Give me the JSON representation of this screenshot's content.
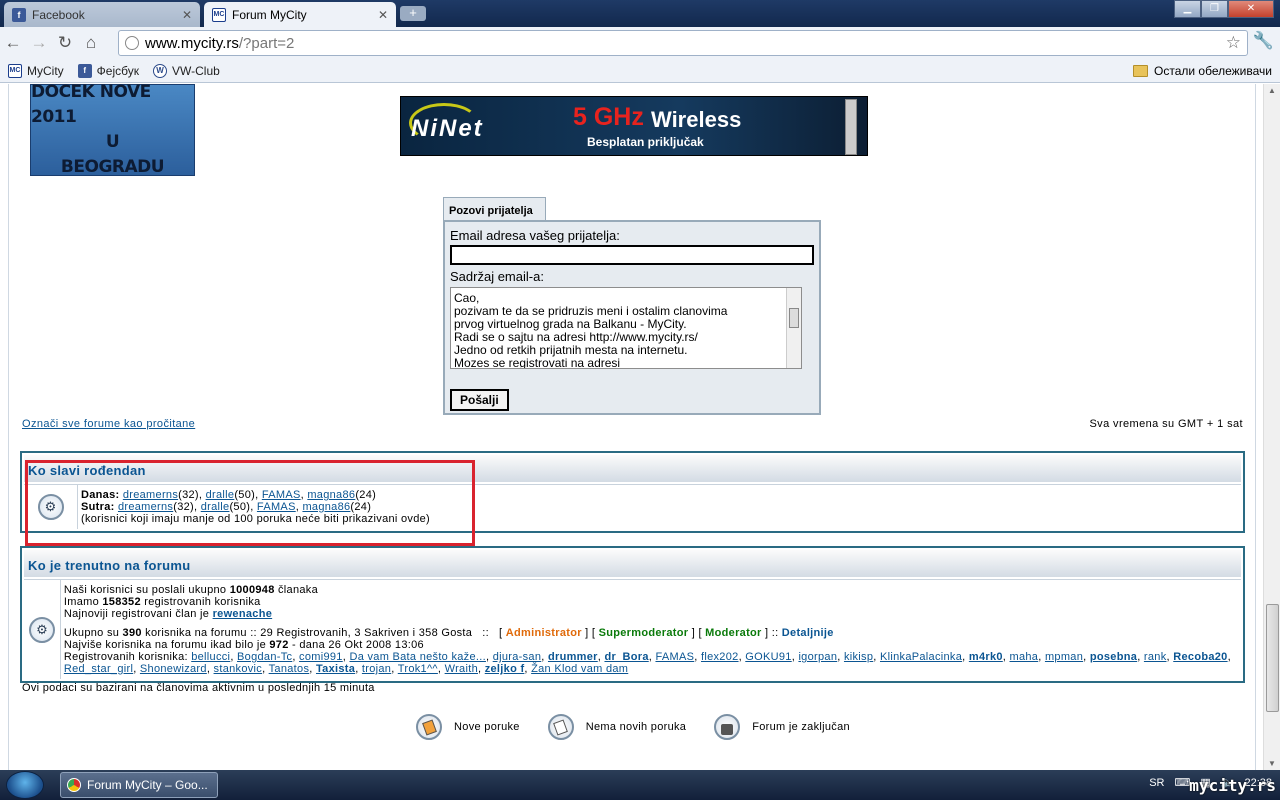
{
  "browser": {
    "tabs": [
      {
        "label": "Facebook",
        "favicon": "facebook-icon"
      },
      {
        "label": "Forum MyCity",
        "favicon": "mycity-icon"
      }
    ],
    "url_domain": "www.mycity.rs",
    "url_path": "/?part=2",
    "bookmarks": [
      "MyCity",
      "Фејсбук",
      "VW-Club"
    ],
    "other_bookmarks": "Остали обележивачи"
  },
  "banners": {
    "left_lines": [
      "DOCEK NOVE 2011",
      "U",
      "BEOGRADU"
    ],
    "ninet_logo": "NiNet",
    "ninet_ghz": "5 GHz",
    "ninet_wireless": "Wireless",
    "ninet_sub": "Besplatan priključak"
  },
  "invite": {
    "tab_label": "Pozovi prijatelja",
    "email_label": "Email adresa vašeg prijatelja:",
    "email_value": "",
    "content_label": "Sadržaj email-a:",
    "content_lines": [
      "Cao,",
      "pozivam te da se pridruzis meni i ostalim clanovima",
      "prvog virtuelnog grada na Balkanu - MyCity.",
      "Radi se o sajtu na adresi http://www.mycity.rs/",
      "Jedno od retkih prijatnih mesta na internetu.",
      "Mozes se registrovati na adresi"
    ],
    "send_label": "Pošalji"
  },
  "mark_read": "Označi sve forume kao pročitane",
  "timezone": "Sva vremena su GMT + 1 sat",
  "birthday": {
    "title": "Ko slavi rođendan",
    "today_label": "Danas:",
    "today_users": [
      {
        "name": "dreamerns",
        "count": "(32)"
      },
      {
        "name": "dralle",
        "count": "(50)"
      },
      {
        "name": "FAMAS",
        "count": ""
      },
      {
        "name": "magna86",
        "count": "(24)"
      }
    ],
    "tomorrow_label": "Sutra:",
    "tomorrow_users": [
      {
        "name": "dreamerns",
        "count": "(32)"
      },
      {
        "name": "dralle",
        "count": "(50)"
      },
      {
        "name": "FAMAS",
        "count": ""
      },
      {
        "name": "magna86",
        "count": "(24)"
      }
    ],
    "note": "(korisnici koji imaju manje od 100 poruka neće biti prikazivani ovde)"
  },
  "online": {
    "title": "Ko je trenutno na forumu",
    "posts_pre": "Naši korisnici su poslali ukupno ",
    "posts_count": "1000948",
    "posts_post": " članaka",
    "members_pre": "Imamo ",
    "members_count": "158352",
    "members_post": " registrovanih korisnika",
    "newest_pre": "Najnoviji registrovani član je ",
    "newest_user": "rewenache",
    "total_pre": "Ukupno su ",
    "total_count": "390",
    "total_post": " korisnika na forumu :: 29 Registrovanih, 3 Sakriven i 358 Gosta   ::   [ ",
    "role_admin": "Administrator",
    "role_sep1": " ] [ ",
    "role_smod": "Supermoderator",
    "role_sep2": " ] [ ",
    "role_mod": "Moderator",
    "role_sep3": " ] :: ",
    "details": "Detaljnije",
    "record_pre": "Najviše korisnika na forumu ikad bilo je ",
    "record_count": "972",
    "record_post": " - dana 26 Okt 2008 13:06",
    "registered_label": "Registrovanih korisnika: ",
    "users": [
      {
        "name": "bellucci",
        "style": "link"
      },
      {
        "name": "Bogdan-Tc",
        "style": "link"
      },
      {
        "name": "comi991",
        "style": "link"
      },
      {
        "name": "Da vam Bata nešto kaže...",
        "style": "link"
      },
      {
        "name": "djura-san",
        "style": "link"
      },
      {
        "name": "drummer",
        "style": "green"
      },
      {
        "name": "dr_Bora",
        "style": "blue"
      },
      {
        "name": "FAMAS",
        "style": "link"
      },
      {
        "name": "flex202",
        "style": "link"
      },
      {
        "name": "GOKU91",
        "style": "link"
      },
      {
        "name": "igorpan",
        "style": "link"
      },
      {
        "name": "kikisp",
        "style": "link"
      },
      {
        "name": "KlinkaPalacinka",
        "style": "link"
      },
      {
        "name": "m4rk0",
        "style": "orange"
      },
      {
        "name": "maha",
        "style": "link"
      },
      {
        "name": "mpman",
        "style": "link"
      },
      {
        "name": "posebna",
        "style": "green"
      },
      {
        "name": "rank",
        "style": "link"
      },
      {
        "name": "Recoba20",
        "style": "bold"
      },
      {
        "name": "Red_star_girl",
        "style": "link"
      },
      {
        "name": "Shonewizard",
        "style": "link"
      },
      {
        "name": "stankovic",
        "style": "link"
      },
      {
        "name": "Tanatos",
        "style": "link"
      },
      {
        "name": "Taxista",
        "style": "bold"
      },
      {
        "name": "trojan",
        "style": "link"
      },
      {
        "name": "Trok1^^",
        "style": "link"
      },
      {
        "name": "Wraith",
        "style": "link"
      },
      {
        "name": "zeljko f",
        "style": "green"
      },
      {
        "name": "Žan Klod vam dam",
        "style": "link"
      }
    ]
  },
  "online_note": "Ovi podaci su bazirani na članovima aktivnim u poslednjih 15 minuta",
  "legend": [
    {
      "label": "Nove poruke",
      "icon": "new-posts-icon"
    },
    {
      "label": "Nema novih poruka",
      "icon": "no-new-posts-icon"
    },
    {
      "label": "Forum je zaključan",
      "icon": "locked-icon"
    }
  ],
  "taskbar": {
    "item": "Forum MyCity – Goo...",
    "lang": "SR",
    "clock": "22:38"
  },
  "watermark": "mycity.rs"
}
